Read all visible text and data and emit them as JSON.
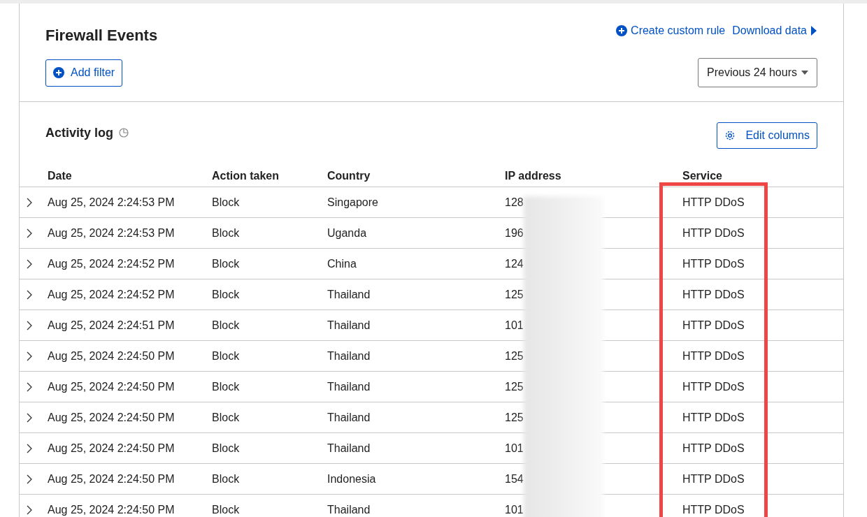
{
  "header": {
    "title": "Firewall Events",
    "links": [
      {
        "label": "Create custom rule",
        "kind": "create"
      },
      {
        "label": "Download data",
        "kind": "download"
      }
    ],
    "add_filter": "Add filter",
    "time_range": "Previous 24 hours"
  },
  "activity_log": {
    "title": "Activity log",
    "edit_columns": "Edit columns",
    "columns": [
      "Date",
      "Action taken",
      "Country",
      "IP address",
      "Service"
    ],
    "rows": [
      {
        "date": "Aug 25, 2024 2:24:53 PM",
        "action": "Block",
        "country": "Singapore",
        "ip": "128",
        "service": "HTTP DDoS"
      },
      {
        "date": "Aug 25, 2024 2:24:53 PM",
        "action": "Block",
        "country": "Uganda",
        "ip": "196",
        "service": "HTTP DDoS"
      },
      {
        "date": "Aug 25, 2024 2:24:52 PM",
        "action": "Block",
        "country": "China",
        "ip": "124",
        "service": "HTTP DDoS"
      },
      {
        "date": "Aug 25, 2024 2:24:52 PM",
        "action": "Block",
        "country": "Thailand",
        "ip": "125",
        "service": "HTTP DDoS"
      },
      {
        "date": "Aug 25, 2024 2:24:51 PM",
        "action": "Block",
        "country": "Thailand",
        "ip": "101",
        "service": "HTTP DDoS"
      },
      {
        "date": "Aug 25, 2024 2:24:50 PM",
        "action": "Block",
        "country": "Thailand",
        "ip": "125",
        "service": "HTTP DDoS"
      },
      {
        "date": "Aug 25, 2024 2:24:50 PM",
        "action": "Block",
        "country": "Thailand",
        "ip": "125",
        "service": "HTTP DDoS"
      },
      {
        "date": "Aug 25, 2024 2:24:50 PM",
        "action": "Block",
        "country": "Thailand",
        "ip": "125",
        "service": "HTTP DDoS"
      },
      {
        "date": "Aug 25, 2024 2:24:50 PM",
        "action": "Block",
        "country": "Thailand",
        "ip": "101",
        "service": "HTTP DDoS"
      },
      {
        "date": "Aug 25, 2024 2:24:50 PM",
        "action": "Block",
        "country": "Indonesia",
        "ip": "154",
        "service": "HTTP DDoS"
      },
      {
        "date": "Aug 25, 2024 2:24:50 PM",
        "action": "Block",
        "country": "Thailand",
        "ip": "101",
        "service": "HTTP DDoS"
      }
    ],
    "ip_redacted": true,
    "service_highlighted": true
  }
}
